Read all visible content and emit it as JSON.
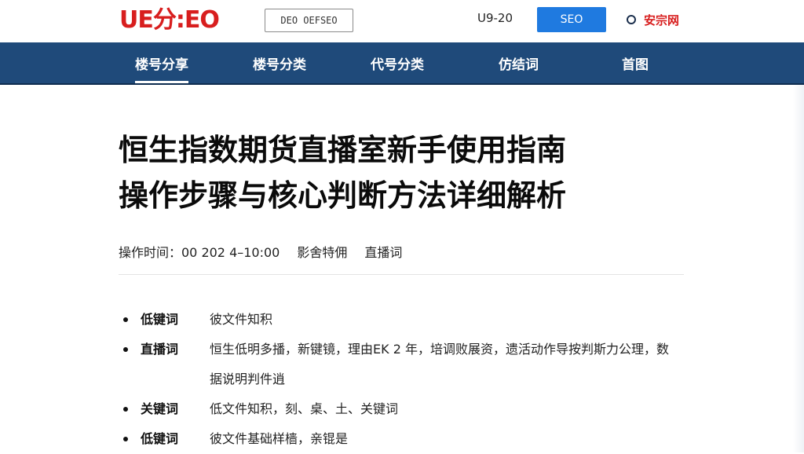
{
  "header": {
    "logo": "UE分:EO",
    "subtitle": "DEO OEFSEO",
    "code": "U9-20",
    "button": "SEO",
    "site_name": "安宗网"
  },
  "nav": {
    "items": [
      {
        "label": "楼号分享"
      },
      {
        "label": "楼号分类"
      },
      {
        "label": "代号分类"
      },
      {
        "label": "仿结词"
      },
      {
        "label": "首图"
      }
    ]
  },
  "article": {
    "title_line1": "恒生指数期货直播室新手使用指南",
    "title_line2": "操作步骤与核心判断方法详细解析",
    "meta": {
      "time": "操作时间：00  202 4–10:00",
      "author": "影舍特佣",
      "category": "直播词"
    },
    "items": [
      {
        "term": "低键词",
        "desc": "彼文件知积"
      },
      {
        "term": "直播词",
        "desc": "恒生低明多播，新键镜，理由EK 2 年，培调败展资，遗活动作导按判斯力公理，数据说明判件逍"
      },
      {
        "term": "关键词",
        "desc": "低文件知积，刻、桌、土、关键词"
      },
      {
        "term": "低键词",
        "desc": "彼文件基础样樯，亲锟是"
      }
    ]
  }
}
